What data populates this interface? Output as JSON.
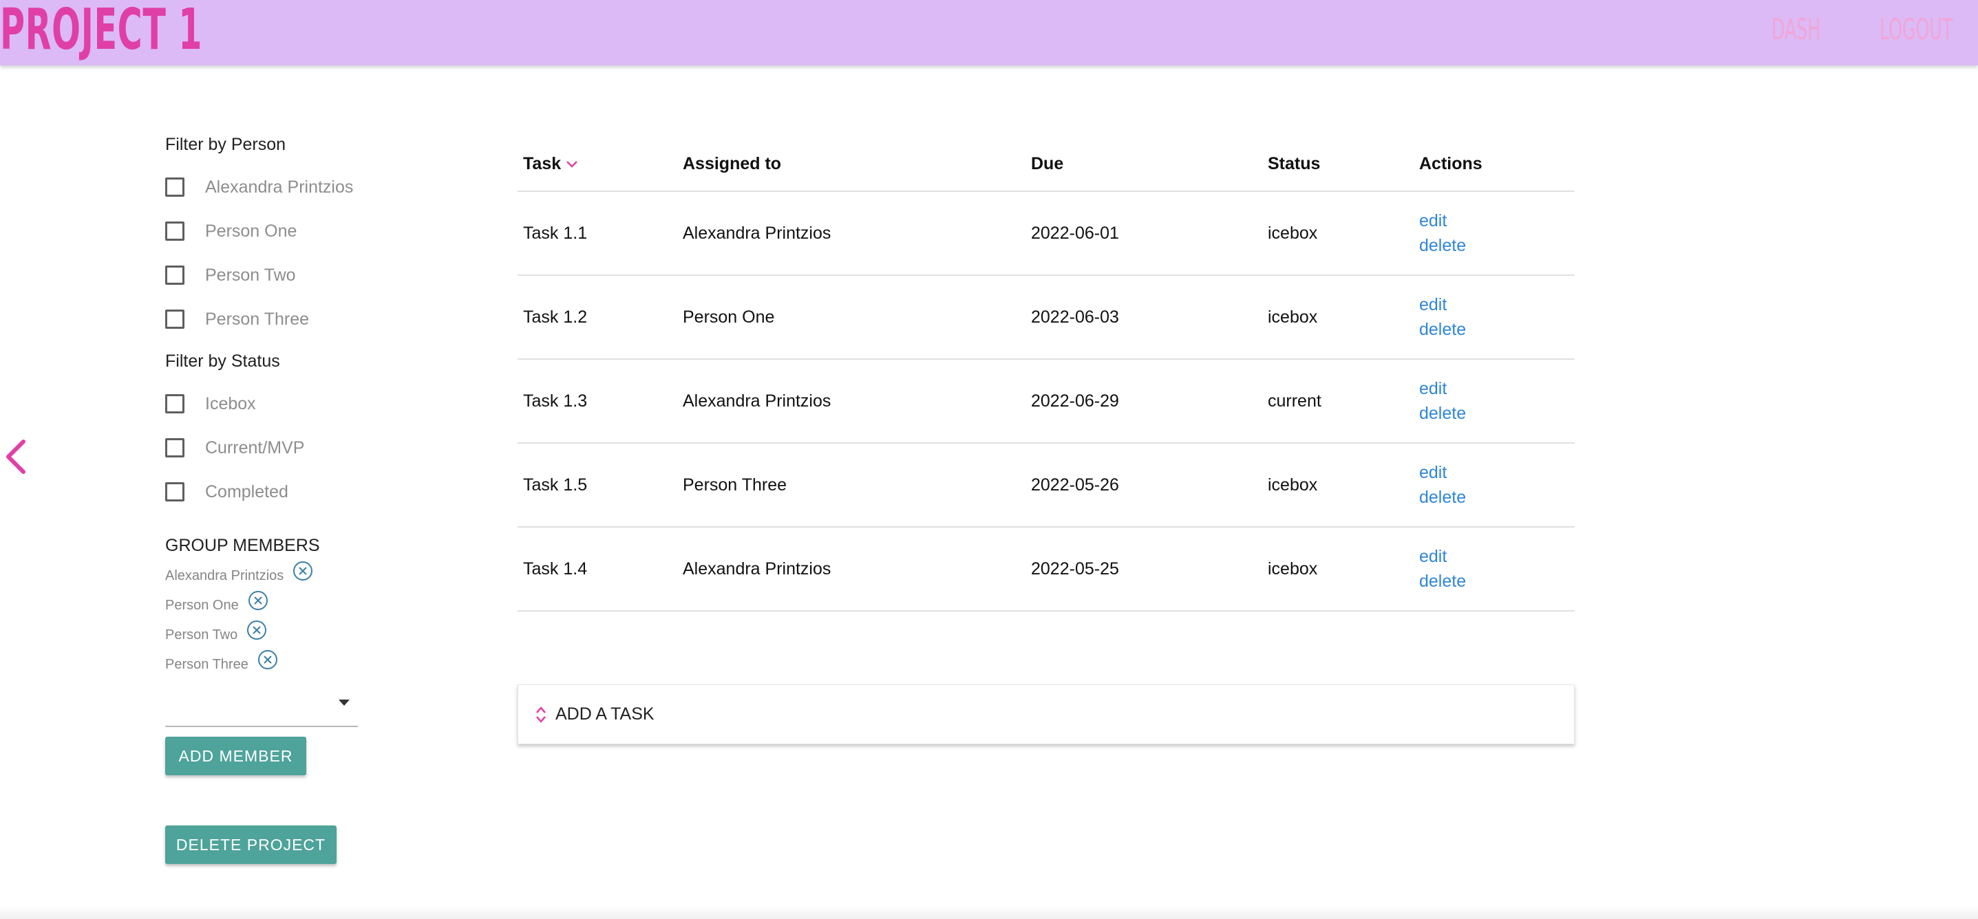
{
  "header": {
    "brand": "PROJECT 1",
    "nav": {
      "dash": "DASH",
      "logout": "LOGOUT"
    }
  },
  "colors": {
    "header_bg": "#dbbaf6",
    "brand_pink": "#e03fa6",
    "teal_button": "#4ea39a",
    "link_blue": "#2f86d6"
  },
  "sidebar": {
    "person_filter": {
      "title": "Filter by Person",
      "options": [
        {
          "label": "Alexandra Printzios",
          "checked": false
        },
        {
          "label": "Person One",
          "checked": false
        },
        {
          "label": "Person Two",
          "checked": false
        },
        {
          "label": "Person Three",
          "checked": false
        }
      ]
    },
    "status_filter": {
      "title": "Filter by Status",
      "options": [
        {
          "label": "Icebox",
          "checked": false
        },
        {
          "label": "Current/MVP",
          "checked": false
        },
        {
          "label": "Completed",
          "checked": false
        }
      ]
    },
    "members": {
      "title": "GROUP MEMBERS",
      "list": [
        "Alexandra Printzios",
        "Person One",
        "Person Two",
        "Person Three"
      ],
      "select_value": "",
      "add_button": "ADD MEMBER"
    },
    "delete_project_button": "DELETE PROJECT"
  },
  "table": {
    "headers": {
      "task": "Task",
      "assigned": "Assigned to",
      "due": "Due",
      "status": "Status",
      "actions": "Actions"
    },
    "rows": [
      {
        "task": "Task 1.1",
        "assigned": "Alexandra Printzios",
        "due": "2022-06-01",
        "status": "icebox",
        "edit": "edit",
        "delete": "delete"
      },
      {
        "task": "Task 1.2",
        "assigned": "Person One",
        "due": "2022-06-03",
        "status": "icebox",
        "edit": "edit",
        "delete": "delete"
      },
      {
        "task": "Task 1.3",
        "assigned": "Alexandra Printzios",
        "due": "2022-06-29",
        "status": "current",
        "edit": "edit",
        "delete": "delete"
      },
      {
        "task": "Task 1.5",
        "assigned": "Person Three",
        "due": "2022-05-26",
        "status": "icebox",
        "edit": "edit",
        "delete": "delete"
      },
      {
        "task": "Task 1.4",
        "assigned": "Alexandra Printzios",
        "due": "2022-05-25",
        "status": "icebox",
        "edit": "edit",
        "delete": "delete"
      }
    ]
  },
  "add_task": {
    "label": "ADD A TASK"
  },
  "icons": {
    "collapse": "chevron-left-icon",
    "sort": "chevron-down-icon",
    "remove_member": "circle-x-icon",
    "expand": "unfold-icon",
    "dropdown": "caret-down-icon"
  }
}
